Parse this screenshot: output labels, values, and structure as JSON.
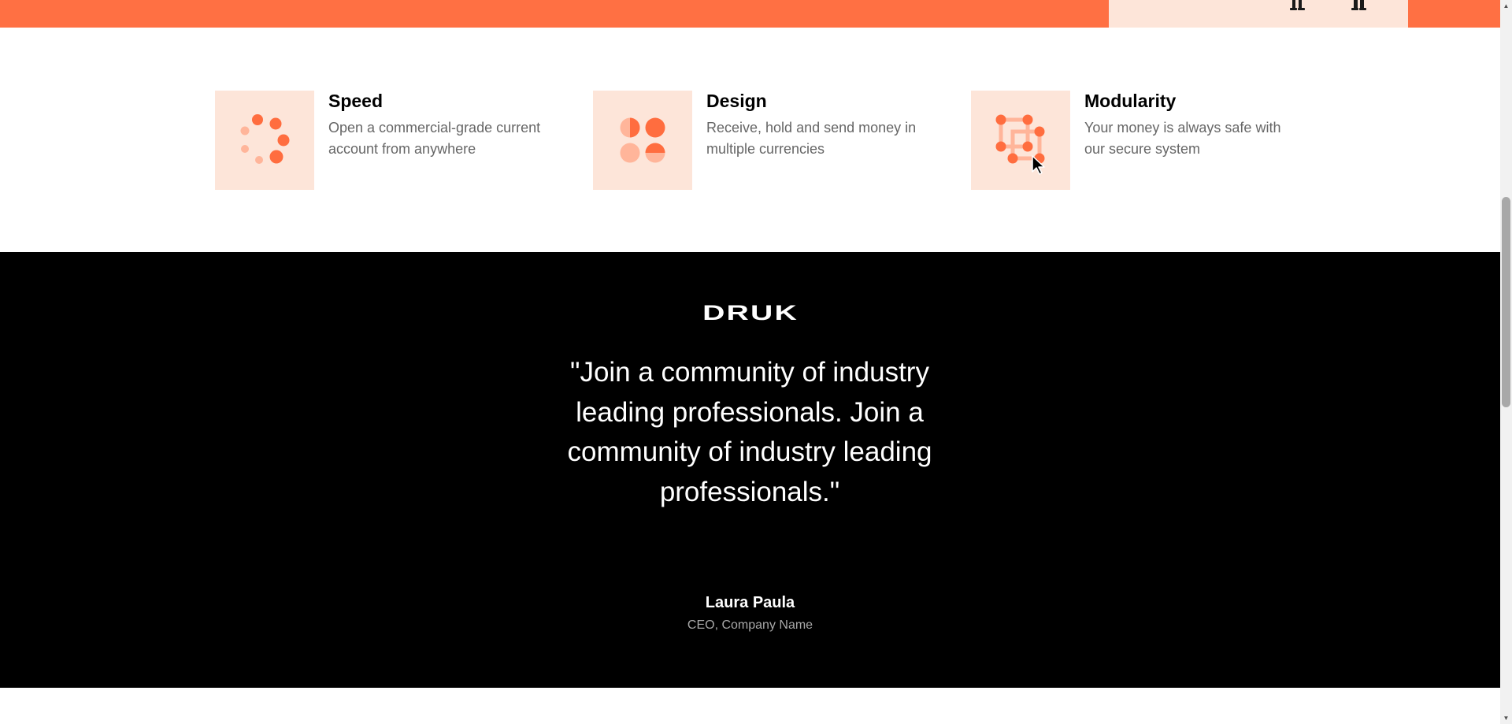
{
  "colors": {
    "accent": "#ff7043",
    "tile_background": "#fde5d9",
    "dark_section": "#000000",
    "muted_text": "#666666"
  },
  "features": [
    {
      "title": "Speed",
      "description": "Open a commercial-grade current account from anywhere",
      "icon": "dots-spinner-icon"
    },
    {
      "title": "Design",
      "description": "Receive, hold and send money in multiple currencies",
      "icon": "circles-grid-icon"
    },
    {
      "title": "Modularity",
      "description": "Your money is always safe with our secure system",
      "icon": "linked-nodes-icon"
    }
  ],
  "testimonial": {
    "brand": "DRUK",
    "quote": "\"Join a community of industry leading professionals. Join a community of industry leading professionals.\"",
    "author_name": "Laura Paula",
    "author_role": "CEO, Company Name"
  }
}
